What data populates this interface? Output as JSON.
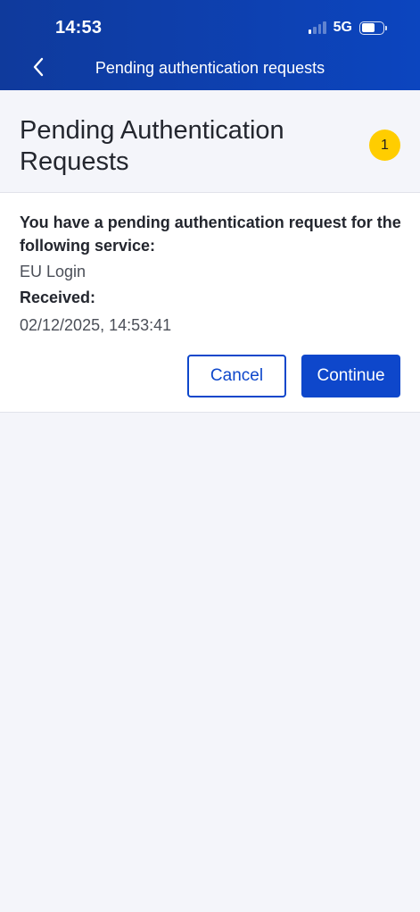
{
  "status_bar": {
    "time": "14:53",
    "network": "5G",
    "signal_bars_active": 1,
    "signal_bars_total": 4,
    "battery_level": 0.62
  },
  "nav": {
    "back_icon": "chevron-left-icon",
    "title": "Pending authentication requests"
  },
  "page": {
    "title": "Pending Authentication Requests",
    "pending_count": "1"
  },
  "request": {
    "message": "You have a pending authentication request for the following service:",
    "service": "EU Login",
    "received_label": "Received:",
    "received_value": "02/12/2025, 14:53:41",
    "cancel_label": "Cancel",
    "continue_label": "Continue"
  },
  "colors": {
    "header_gradient_start": "#0f3a9c",
    "header_gradient_end": "#0c45bf",
    "primary": "#0e47cb",
    "badge": "#ffcd00",
    "background": "#f4f5fa"
  }
}
